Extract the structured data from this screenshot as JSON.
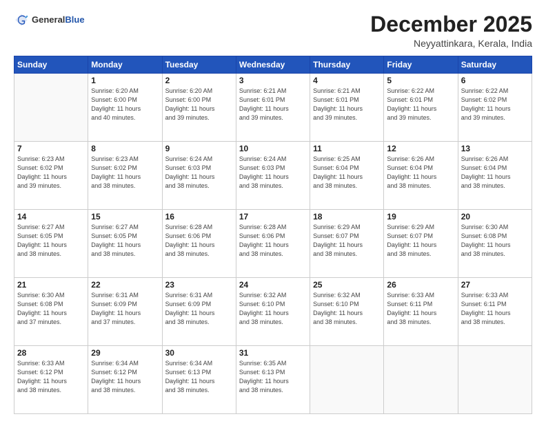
{
  "header": {
    "logo": {
      "general": "General",
      "blue": "Blue"
    },
    "title": "December 2025",
    "location": "Neyyattinkara, Kerala, India"
  },
  "weekdays": [
    "Sunday",
    "Monday",
    "Tuesday",
    "Wednesday",
    "Thursday",
    "Friday",
    "Saturday"
  ],
  "weeks": [
    [
      {
        "day": "",
        "info": ""
      },
      {
        "day": "1",
        "info": "Sunrise: 6:20 AM\nSunset: 6:00 PM\nDaylight: 11 hours\nand 40 minutes."
      },
      {
        "day": "2",
        "info": "Sunrise: 6:20 AM\nSunset: 6:00 PM\nDaylight: 11 hours\nand 39 minutes."
      },
      {
        "day": "3",
        "info": "Sunrise: 6:21 AM\nSunset: 6:01 PM\nDaylight: 11 hours\nand 39 minutes."
      },
      {
        "day": "4",
        "info": "Sunrise: 6:21 AM\nSunset: 6:01 PM\nDaylight: 11 hours\nand 39 minutes."
      },
      {
        "day": "5",
        "info": "Sunrise: 6:22 AM\nSunset: 6:01 PM\nDaylight: 11 hours\nand 39 minutes."
      },
      {
        "day": "6",
        "info": "Sunrise: 6:22 AM\nSunset: 6:02 PM\nDaylight: 11 hours\nand 39 minutes."
      }
    ],
    [
      {
        "day": "7",
        "info": "Sunrise: 6:23 AM\nSunset: 6:02 PM\nDaylight: 11 hours\nand 39 minutes."
      },
      {
        "day": "8",
        "info": "Sunrise: 6:23 AM\nSunset: 6:02 PM\nDaylight: 11 hours\nand 38 minutes."
      },
      {
        "day": "9",
        "info": "Sunrise: 6:24 AM\nSunset: 6:03 PM\nDaylight: 11 hours\nand 38 minutes."
      },
      {
        "day": "10",
        "info": "Sunrise: 6:24 AM\nSunset: 6:03 PM\nDaylight: 11 hours\nand 38 minutes."
      },
      {
        "day": "11",
        "info": "Sunrise: 6:25 AM\nSunset: 6:04 PM\nDaylight: 11 hours\nand 38 minutes."
      },
      {
        "day": "12",
        "info": "Sunrise: 6:26 AM\nSunset: 6:04 PM\nDaylight: 11 hours\nand 38 minutes."
      },
      {
        "day": "13",
        "info": "Sunrise: 6:26 AM\nSunset: 6:04 PM\nDaylight: 11 hours\nand 38 minutes."
      }
    ],
    [
      {
        "day": "14",
        "info": "Sunrise: 6:27 AM\nSunset: 6:05 PM\nDaylight: 11 hours\nand 38 minutes."
      },
      {
        "day": "15",
        "info": "Sunrise: 6:27 AM\nSunset: 6:05 PM\nDaylight: 11 hours\nand 38 minutes."
      },
      {
        "day": "16",
        "info": "Sunrise: 6:28 AM\nSunset: 6:06 PM\nDaylight: 11 hours\nand 38 minutes."
      },
      {
        "day": "17",
        "info": "Sunrise: 6:28 AM\nSunset: 6:06 PM\nDaylight: 11 hours\nand 38 minutes."
      },
      {
        "day": "18",
        "info": "Sunrise: 6:29 AM\nSunset: 6:07 PM\nDaylight: 11 hours\nand 38 minutes."
      },
      {
        "day": "19",
        "info": "Sunrise: 6:29 AM\nSunset: 6:07 PM\nDaylight: 11 hours\nand 38 minutes."
      },
      {
        "day": "20",
        "info": "Sunrise: 6:30 AM\nSunset: 6:08 PM\nDaylight: 11 hours\nand 38 minutes."
      }
    ],
    [
      {
        "day": "21",
        "info": "Sunrise: 6:30 AM\nSunset: 6:08 PM\nDaylight: 11 hours\nand 37 minutes."
      },
      {
        "day": "22",
        "info": "Sunrise: 6:31 AM\nSunset: 6:09 PM\nDaylight: 11 hours\nand 37 minutes."
      },
      {
        "day": "23",
        "info": "Sunrise: 6:31 AM\nSunset: 6:09 PM\nDaylight: 11 hours\nand 38 minutes."
      },
      {
        "day": "24",
        "info": "Sunrise: 6:32 AM\nSunset: 6:10 PM\nDaylight: 11 hours\nand 38 minutes."
      },
      {
        "day": "25",
        "info": "Sunrise: 6:32 AM\nSunset: 6:10 PM\nDaylight: 11 hours\nand 38 minutes."
      },
      {
        "day": "26",
        "info": "Sunrise: 6:33 AM\nSunset: 6:11 PM\nDaylight: 11 hours\nand 38 minutes."
      },
      {
        "day": "27",
        "info": "Sunrise: 6:33 AM\nSunset: 6:11 PM\nDaylight: 11 hours\nand 38 minutes."
      }
    ],
    [
      {
        "day": "28",
        "info": "Sunrise: 6:33 AM\nSunset: 6:12 PM\nDaylight: 11 hours\nand 38 minutes."
      },
      {
        "day": "29",
        "info": "Sunrise: 6:34 AM\nSunset: 6:12 PM\nDaylight: 11 hours\nand 38 minutes."
      },
      {
        "day": "30",
        "info": "Sunrise: 6:34 AM\nSunset: 6:13 PM\nDaylight: 11 hours\nand 38 minutes."
      },
      {
        "day": "31",
        "info": "Sunrise: 6:35 AM\nSunset: 6:13 PM\nDaylight: 11 hours\nand 38 minutes."
      },
      {
        "day": "",
        "info": ""
      },
      {
        "day": "",
        "info": ""
      },
      {
        "day": "",
        "info": ""
      }
    ]
  ]
}
